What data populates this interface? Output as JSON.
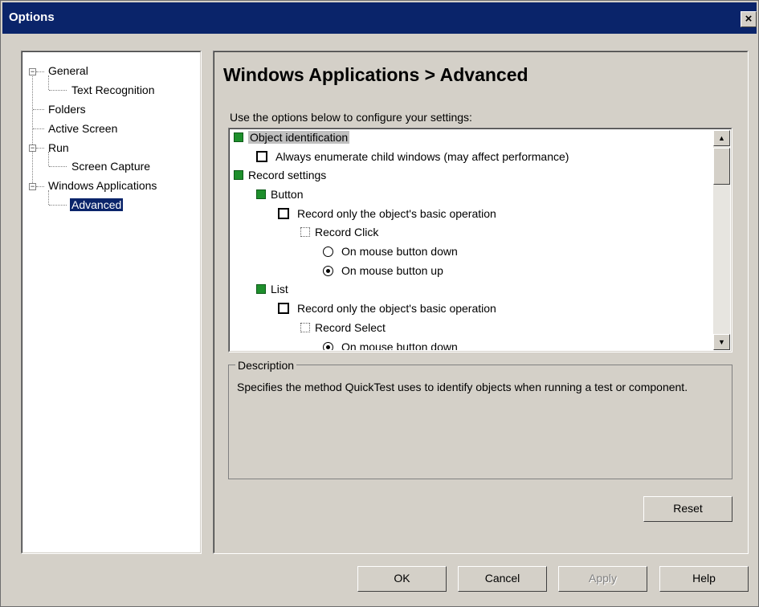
{
  "window": {
    "title": "Options",
    "close_glyph": "×"
  },
  "nav": {
    "items": [
      {
        "label": "General"
      },
      {
        "label": "Text Recognition"
      },
      {
        "label": "Folders"
      },
      {
        "label": "Active Screen"
      },
      {
        "label": "Run"
      },
      {
        "label": "Screen Capture"
      },
      {
        "label": "Windows Applications"
      },
      {
        "label": "Advanced"
      }
    ],
    "expander_glyph": "−"
  },
  "panel": {
    "heading": "Windows Applications > Advanced",
    "hint": "Use the options below to configure your settings:",
    "settings": [
      {
        "label": "Object identification"
      },
      {
        "label": "Always enumerate child windows (may affect performance)"
      },
      {
        "label": "Record settings"
      },
      {
        "label": "Button"
      },
      {
        "label": "Record only the object's basic operation"
      },
      {
        "label": "Record Click"
      },
      {
        "label": "On mouse button down"
      },
      {
        "label": "On mouse button up"
      },
      {
        "label": "List"
      },
      {
        "label": "Record only the object's basic operation"
      },
      {
        "label": "Record Select"
      },
      {
        "label": "On mouse button down"
      }
    ],
    "description_legend": "Description",
    "description_text": "Specifies the method QuickTest uses to identify objects when running a test or component.",
    "reset_label": "Reset"
  },
  "footer": {
    "ok_label": "OK",
    "cancel_label": "Cancel",
    "apply_label": "Apply",
    "help_label": "Help"
  },
  "icons": {
    "scroll_up": "▲",
    "scroll_down": "▼"
  }
}
